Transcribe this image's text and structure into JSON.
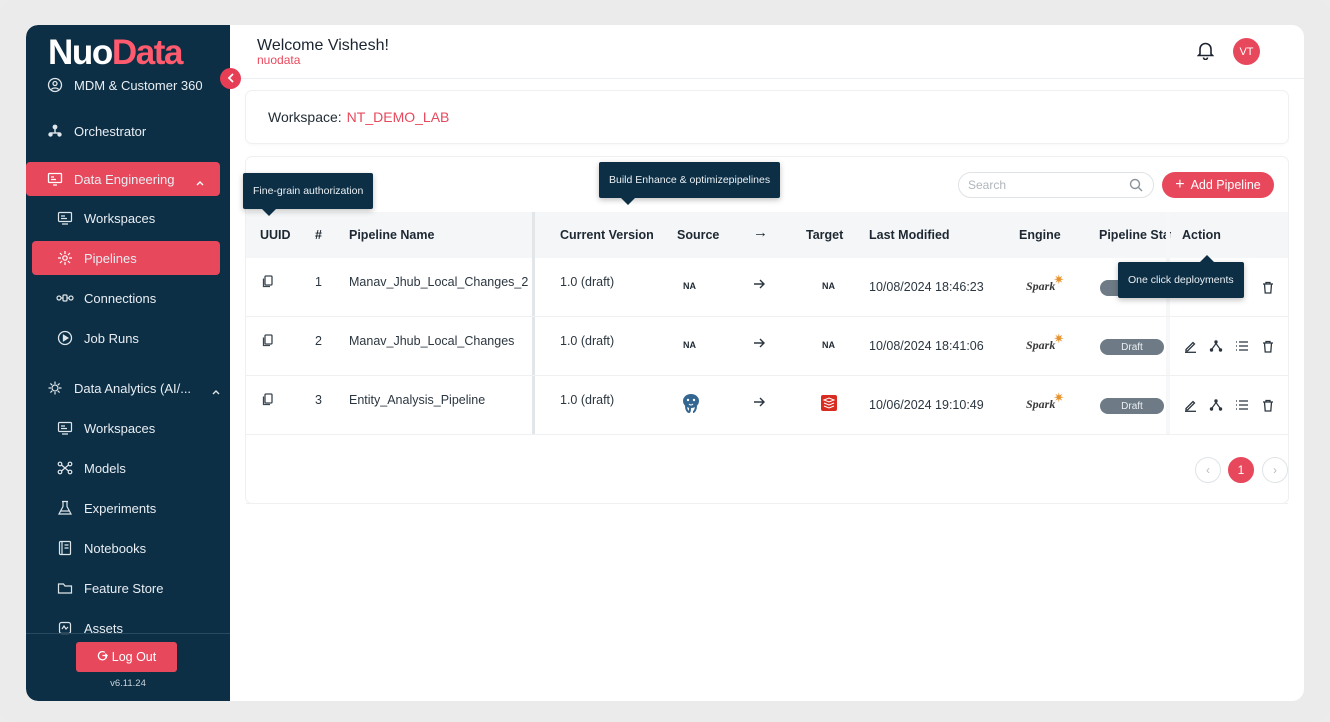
{
  "brand": {
    "part1": "Nuo",
    "part2": "Data"
  },
  "sidebar": {
    "items": [
      {
        "label": "MDM & Customer 360"
      },
      {
        "label": "Orchestrator"
      },
      {
        "label": "Data Engineering"
      },
      {
        "label": "Workspaces"
      },
      {
        "label": "Pipelines"
      },
      {
        "label": "Connections"
      },
      {
        "label": "Job Runs"
      },
      {
        "label": "Data Analytics (AI/..."
      },
      {
        "label": "Workspaces"
      },
      {
        "label": "Models"
      },
      {
        "label": "Experiments"
      },
      {
        "label": "Notebooks"
      },
      {
        "label": "Feature Store"
      },
      {
        "label": "Assets"
      }
    ],
    "logout_label": "Log Out",
    "version": "v6.11.24"
  },
  "header": {
    "welcome": "Welcome Vishesh!",
    "org": "nuodata",
    "avatar_initials": "VT"
  },
  "workspace": {
    "label": "Workspace:",
    "value": "NT_DEMO_LAB"
  },
  "toolbar": {
    "search_placeholder": "Search",
    "add_label": "Add Pipeline"
  },
  "table": {
    "columns": [
      "UUID",
      "#",
      "Pipeline Name",
      "Current Version",
      "Source",
      "→",
      "Target",
      "Last Modified",
      "Engine",
      "Pipeline Stat",
      "Action"
    ],
    "rows": [
      {
        "num": "1",
        "name": "Manav_Jhub_Local_Changes_2",
        "version": "1.0 (draft)",
        "source": "NA",
        "target": "NA",
        "modified": "10/08/2024 18:46:23",
        "engine": "Spark",
        "status": "Draft"
      },
      {
        "num": "2",
        "name": "Manav_Jhub_Local_Changes",
        "version": "1.0 (draft)",
        "source": "NA",
        "target": "NA",
        "modified": "10/08/2024 18:41:06",
        "engine": "Spark",
        "status": "Draft"
      },
      {
        "num": "3",
        "name": "Entity_Analysis_Pipeline",
        "version": "1.0 (draft)",
        "source": "postgres",
        "target": "redis",
        "modified": "10/06/2024 19:10:49",
        "engine": "Spark",
        "status": "Draft"
      }
    ]
  },
  "pagination": {
    "current": "1"
  },
  "tooltips": {
    "uuid": "Fine-grain authorization",
    "version": "Build Enhance & optimizepipelines",
    "action": "One click deployments"
  },
  "colors": {
    "accent": "#e8485c",
    "sidebar": "#0d2f45"
  }
}
